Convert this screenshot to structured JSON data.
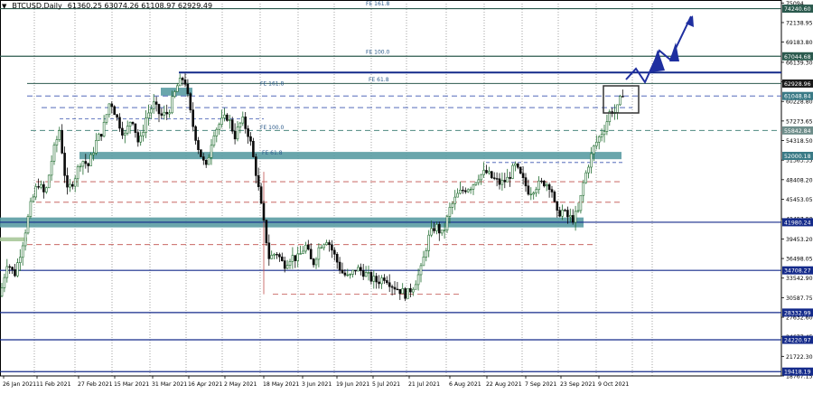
{
  "header": {
    "symbol_text": "BTCUSD,Daily",
    "ohlc_text": "61360.25 63074.26 61108.97 62929.49"
  },
  "chart_data": {
    "type": "candlestick",
    "symbol": "BTCUSD",
    "timeframe": "Daily",
    "last_bar": {
      "open": 61360.25,
      "high": 63074.26,
      "low": 61108.97,
      "close": 62929.49
    },
    "ylim": [
      18765,
      75000
    ],
    "price_axis_ticks": [
      75094,
      72138.95,
      69183.8,
      66139.3,
      63184.15,
      60228.8,
      57273.65,
      54318.5,
      51363.35,
      48408.2,
      45453.05,
      42497.9,
      39453.2,
      36498.05,
      33542.9,
      30587.75,
      27632.6,
      24677.45,
      21722.3,
      18767.15
    ],
    "time_labels": [
      "26 Jan 2021",
      "11 Feb 2021",
      "27 Feb 2021",
      "15 Mar 2021",
      "31 Mar 2021",
      "16 Apr 2021",
      "2 May 2021",
      "18 May 2021",
      "3 Jun 2021",
      "19 Jun 2021",
      "5 Jul 2021",
      "21 Jul 2021",
      "6 Aug 2021",
      "22 Aug 2021",
      "7 Sep 2021",
      "23 Sep 2021",
      "9 Oct 2021"
    ],
    "price_labels": [
      {
        "text": "74240.60",
        "value": 74240.6,
        "color": "#2b5a4e"
      },
      {
        "text": "67044.68",
        "value": 67044.68,
        "color": "#2b5a4e"
      },
      {
        "text": "62928.96",
        "value": 62928.96,
        "color": "#1a1a1a"
      },
      {
        "text": "61048.84",
        "value": 61048.84,
        "color": "#3a7a86"
      },
      {
        "text": "55842.84",
        "value": 55842.84,
        "color": "#6e8d8a"
      },
      {
        "text": "52000.18",
        "value": 52000.18,
        "color": "#3a7a86"
      },
      {
        "text": "41980.24",
        "value": 41980.24,
        "color": "#142a8a"
      },
      {
        "text": "34708.27",
        "value": 34708.27,
        "color": "#142a8a"
      },
      {
        "text": "28332.99",
        "value": 28332.99,
        "color": "#142a8a"
      },
      {
        "text": "24220.97",
        "value": 24220.97,
        "color": "#142a8a"
      },
      {
        "text": "19418.19",
        "value": 19418.19,
        "color": "#142a8a"
      }
    ],
    "fib_labels": [
      {
        "text": "FE 161.8",
        "value": 74600,
        "x": 405
      },
      {
        "text": "FE 100.0",
        "value": 67300,
        "x": 405
      },
      {
        "text": "FE 61.8",
        "value": 63100,
        "x": 408
      },
      {
        "text": "FE 161.8",
        "value": 62500,
        "x": 288
      },
      {
        "text": "FE 100.0",
        "value": 55900,
        "x": 288
      },
      {
        "text": "FE 61.8",
        "value": 52100,
        "x": 290
      }
    ],
    "colors": {
      "bull": "#1f6b2e",
      "bear": "#0a0a0a",
      "support_blue": "#142a8a",
      "zone_teal": "#5a9ca3",
      "fib_green": "#2b5a4e",
      "dashed_red": "#c0504d",
      "dashed_blue": "#3b55b0",
      "arrow": "#1f2fa0"
    }
  }
}
